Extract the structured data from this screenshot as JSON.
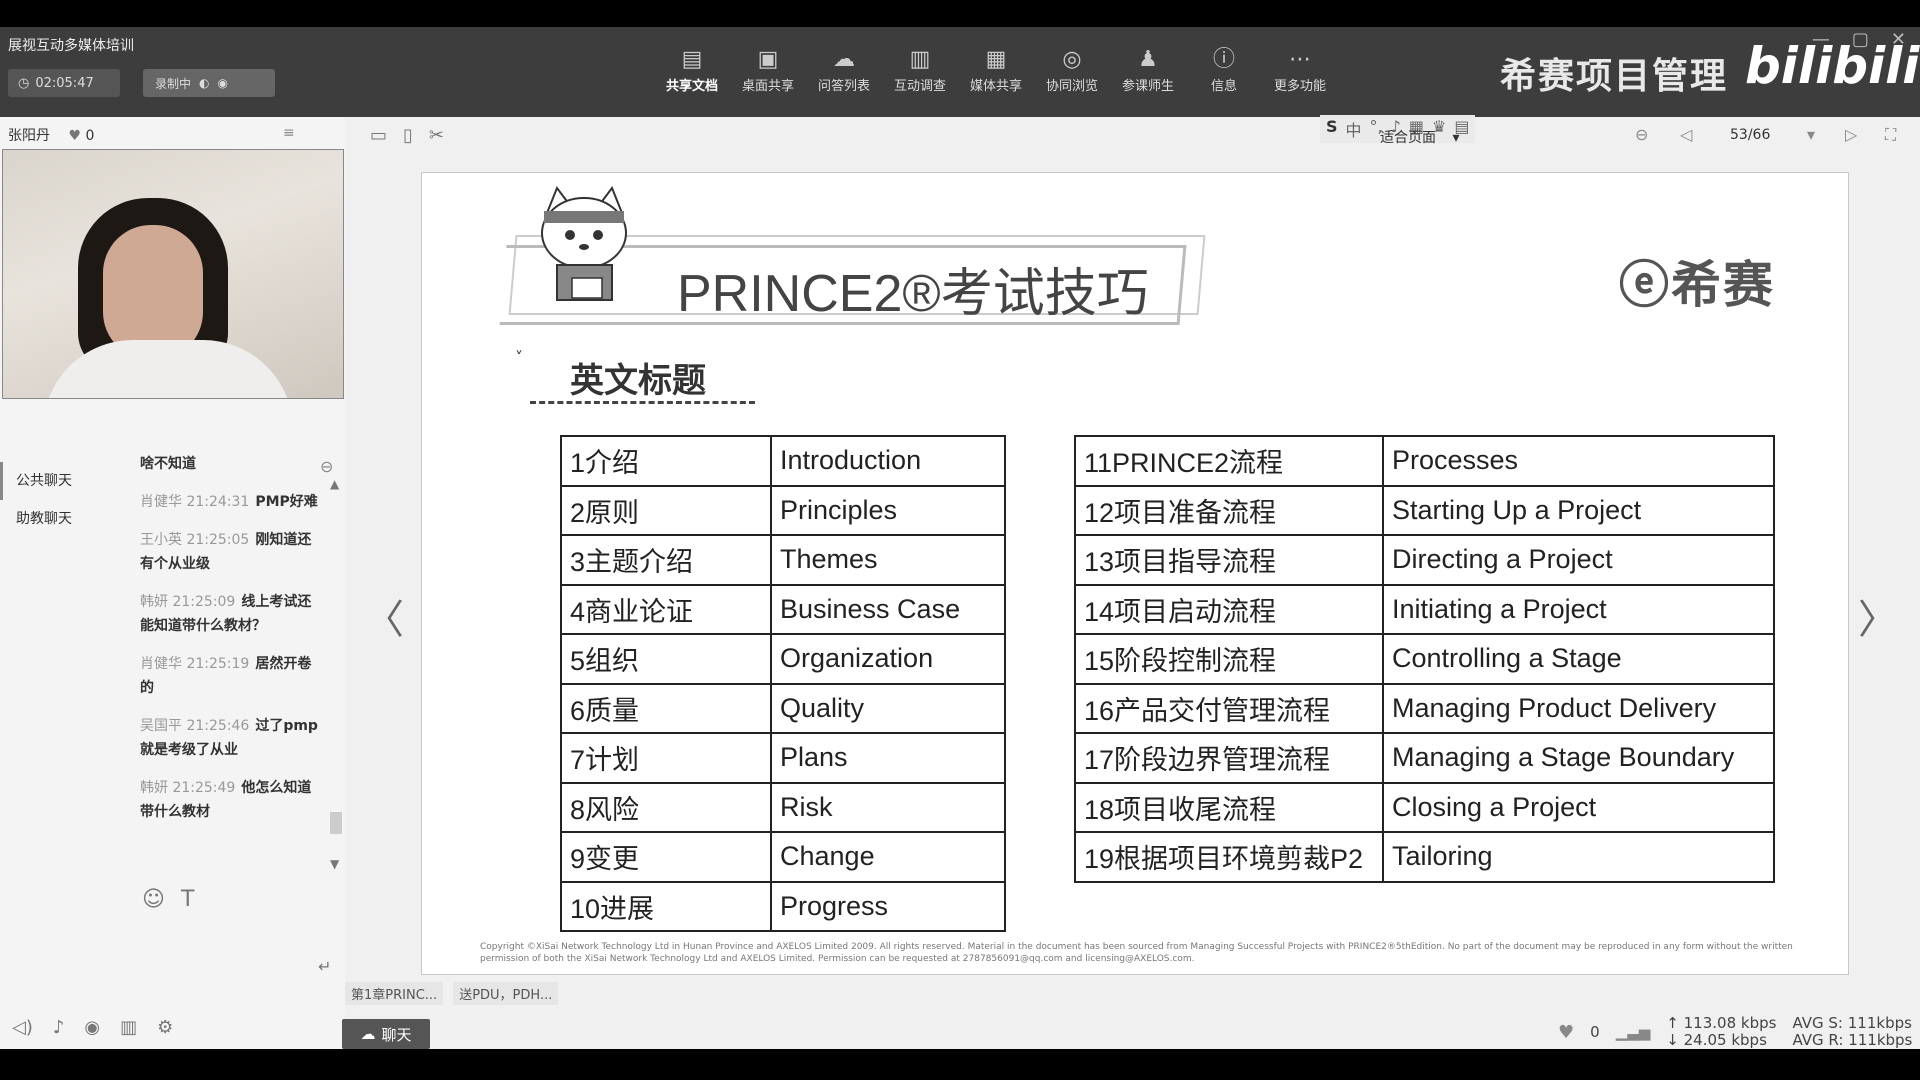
{
  "app_title": "展视互动多媒体培训",
  "timer": "02:05:47",
  "record_label": "录制中",
  "toolbar": [
    {
      "icon": "share-doc-icon",
      "glyph": "▤",
      "label": "共享文档",
      "active": true
    },
    {
      "icon": "desktop-share-icon",
      "glyph": "▣",
      "label": "桌面共享"
    },
    {
      "icon": "qa-list-icon",
      "glyph": "☁",
      "label": "问答列表"
    },
    {
      "icon": "survey-icon",
      "glyph": "▥",
      "label": "互动调查"
    },
    {
      "icon": "media-share-icon",
      "glyph": "▦",
      "label": "媒体共享"
    },
    {
      "icon": "co-browse-icon",
      "glyph": "◎",
      "label": "协同浏览"
    },
    {
      "icon": "participants-icon",
      "glyph": "♟",
      "label": "参课师生"
    },
    {
      "icon": "info-icon",
      "glyph": "ⓘ",
      "label": "信息"
    },
    {
      "icon": "more-icon",
      "glyph": "⋯",
      "label": "更多功能"
    }
  ],
  "brand": "希赛项目管理",
  "bilibili": "bilibili",
  "presenter": {
    "name": "张阳丹",
    "likes": "0"
  },
  "chat": {
    "tabs": [
      "公共聊天",
      "助教聊天"
    ],
    "messages": [
      {
        "meta": "",
        "text": "啥不知道"
      },
      {
        "meta": "肖健华 21:24:31",
        "text": "PMP好难"
      },
      {
        "meta": "王小英 21:25:05",
        "text": "刚知道还有个从业级"
      },
      {
        "meta": "韩妍 21:25:09",
        "text": "线上考试还能知道带什么教材？"
      },
      {
        "meta": "肖健华 21:25:19",
        "text": "居然开卷的"
      },
      {
        "meta": "吴国平 21:25:46",
        "text": "过了pmp就是考级了从业"
      },
      {
        "meta": "韩妍 21:25:49",
        "text": "他怎么知道带什么教材"
      }
    ]
  },
  "doc": {
    "fit_label": "适合页面",
    "page": "53/66"
  },
  "slide": {
    "title": "PRINCE2®考试技巧",
    "logo": "ⓔ希赛",
    "subtitle": "英文标题",
    "left_table": [
      [
        "1介绍",
        "Introduction"
      ],
      [
        "2原则",
        "Principles"
      ],
      [
        "3主题介绍",
        "Themes"
      ],
      [
        "4商业论证",
        "Business Case"
      ],
      [
        "5组织",
        "Organization"
      ],
      [
        "6质量",
        "Quality"
      ],
      [
        "7计划",
        "Plans"
      ],
      [
        "8风险",
        "Risk"
      ],
      [
        "9变更",
        "Change"
      ],
      [
        "10进展",
        "Progress"
      ]
    ],
    "right_table": [
      [
        "11PRINCE2流程",
        "Processes"
      ],
      [
        "12项目准备流程",
        "Starting Up a Project"
      ],
      [
        "13项目指导流程",
        "Directing a Project"
      ],
      [
        "14项目启动流程",
        "Initiating a Project"
      ],
      [
        "15阶段控制流程",
        "Controlling a Stage"
      ],
      [
        "16产品交付管理流程",
        "Managing Product Delivery"
      ],
      [
        "17阶段边界管理流程",
        "Managing a Stage Boundary"
      ],
      [
        "18项目收尾流程",
        "Closing a Project"
      ],
      [
        "19根据项目环境剪裁P2",
        "Tailoring"
      ]
    ],
    "copyright": "Copyright ©XiSai Network Technology Ltd in Hunan Province and AXELOS Limited 2009. All rights reserved. Material in the document has been sourced from Managing Successful Projects with PRINCE2®5thEdition. No part of the document may be reproduced in any form without the written permission of both the XiSai Network Technology Ltd and AXELOS Limited. Permission can be requested at 2787856091@qq.com and licensing@AXELOS.com."
  },
  "bottom_tabs": [
    "第1章PRINC...",
    "送PDU，PDH..."
  ],
  "chat_button": "聊天",
  "stats": {
    "likes": "0",
    "up": "113.08 kbps",
    "down": "24.05 kbps",
    "avg_s": "AVG S: 111kbps",
    "avg_r": "AVG R: 111kbps"
  }
}
